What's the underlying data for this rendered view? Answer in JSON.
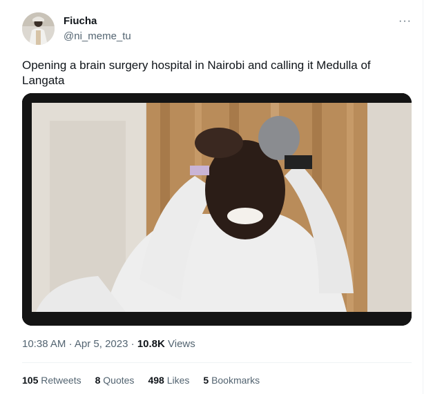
{
  "tweet": {
    "author": {
      "display_name": "Fiucha",
      "handle": "@ni_meme_tu",
      "avatar_icon": "avatar-image"
    },
    "more_icon": "ellipsis-icon",
    "more_glyph": "···",
    "text": "Opening a brain surgery hospital in Nairobi and calling it Medulla of Langata",
    "media": {
      "description_icon": "video-still-image"
    },
    "time": "10:38 AM",
    "separator": "·",
    "date": "Apr 5, 2023",
    "views_count": "10.8K",
    "views_label": "Views",
    "stats": {
      "retweets_count": "105",
      "retweets_label": "Retweets",
      "quotes_count": "8",
      "quotes_label": "Quotes",
      "likes_count": "498",
      "likes_label": "Likes",
      "bookmarks_count": "5",
      "bookmarks_label": "Bookmarks"
    }
  },
  "colors": {
    "text_primary": "#0f1419",
    "text_secondary": "#536471",
    "border": "#eff3f4"
  }
}
